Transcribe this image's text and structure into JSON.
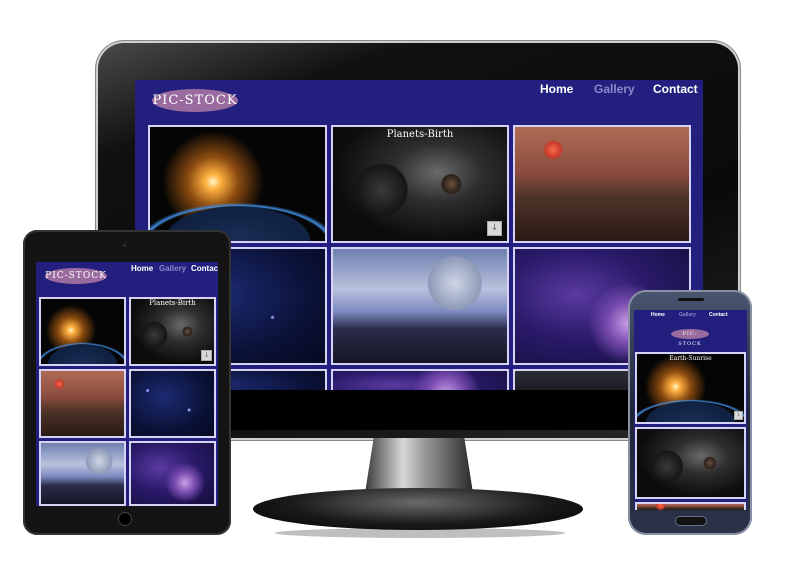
{
  "site": {
    "logo": "PIC-STOCK",
    "nav": [
      {
        "label": "Home",
        "state": "active"
      },
      {
        "label": "Gallery",
        "state": "muted"
      },
      {
        "label": "Contact",
        "state": "active"
      }
    ]
  },
  "monitor": {
    "tiles": [
      {
        "image": "earth-sunrise-photo",
        "caption": ""
      },
      {
        "image": "planets-birth-photo",
        "caption": "Planets-Birth",
        "download": true
      },
      {
        "image": "alien-landscape-photo",
        "caption": ""
      },
      {
        "image": "starfield-photo",
        "caption": ""
      },
      {
        "image": "city-planet-photo",
        "caption": ""
      },
      {
        "image": "nebula-planet-photo",
        "caption": ""
      }
    ]
  },
  "tablet": {
    "tiles": [
      {
        "image": "earth-sunrise-photo",
        "caption": ""
      },
      {
        "image": "planets-birth-photo",
        "caption": "Planets-Birth",
        "download": true
      },
      {
        "image": "alien-landscape-photo",
        "caption": ""
      },
      {
        "image": "starfield-photo",
        "caption": ""
      },
      {
        "image": "city-planet-photo",
        "caption": ""
      },
      {
        "image": "nebula-planet-photo",
        "caption": ""
      }
    ]
  },
  "phone": {
    "tiles": [
      {
        "image": "earth-sunrise-photo",
        "caption": "Earth-Sunrise",
        "download": true
      },
      {
        "image": "planets-birth-photo",
        "caption": ""
      }
    ]
  },
  "colors": {
    "site_bg": "#231f7e",
    "logo_bg": "#9a6b9e",
    "tile_border": "#d6d3f4",
    "nav_muted": "#8a88c8"
  },
  "icons": {
    "download": "download-icon"
  }
}
